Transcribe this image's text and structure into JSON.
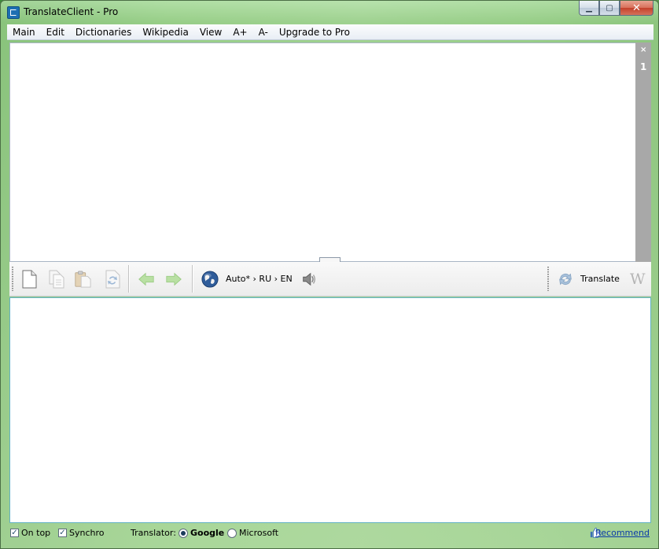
{
  "window": {
    "title": "TranslateClient - Pro",
    "controls": {
      "minimize": "▁",
      "maximize": "▢",
      "close": "✕"
    }
  },
  "menu": {
    "items": [
      "Main",
      "Edit",
      "Dictionaries",
      "Wikipedia",
      "View",
      "A+",
      "A-",
      "Upgrade to Pro"
    ]
  },
  "editor": {
    "value": "",
    "side_panel": {
      "close": "×",
      "count": "1"
    }
  },
  "toolbar": {
    "language_pair": "Auto* › RU › EN",
    "translate_label": "Translate",
    "icons": [
      "new-document-icon",
      "copy-icon",
      "paste-icon",
      "swap-icon",
      "back-arrow-icon",
      "forward-arrow-icon",
      "globe-icon",
      "speaker-icon",
      "refresh-icon",
      "wikipedia-icon"
    ],
    "wikipedia_glyph": "W"
  },
  "status": {
    "on_top": {
      "label": "On top",
      "checked": true
    },
    "synchro": {
      "label": "Synchro",
      "checked": true
    },
    "translator_label": "Translator:",
    "translators": [
      {
        "label": "Google",
        "selected": true
      },
      {
        "label": "Microsoft",
        "selected": false
      }
    ],
    "recommend": "Recommend",
    "check_glyph": "✓"
  }
}
